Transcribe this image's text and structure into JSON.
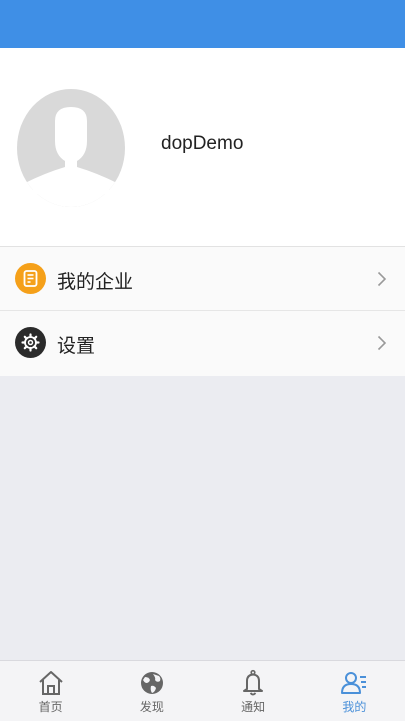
{
  "colors": {
    "header": "#3f8fe6",
    "background": "#ebecf1",
    "active_tab": "#4a90d9",
    "inactive_tab": "#666666",
    "enterprise_icon_bg": "#f5a019",
    "settings_icon_bg": "#2b2b2b"
  },
  "profile": {
    "username": "dopDemo",
    "avatar_icon": "default-person-avatar"
  },
  "menu": {
    "items": [
      {
        "label": "我的企业",
        "icon": "document-icon"
      },
      {
        "label": "设置",
        "icon": "gear-icon"
      }
    ]
  },
  "tabs": [
    {
      "label": "首页",
      "icon": "home-icon",
      "active": false
    },
    {
      "label": "发现",
      "icon": "globe-icon",
      "active": false
    },
    {
      "label": "通知",
      "icon": "bell-icon",
      "active": false
    },
    {
      "label": "我的",
      "icon": "user-list-icon",
      "active": true
    }
  ]
}
